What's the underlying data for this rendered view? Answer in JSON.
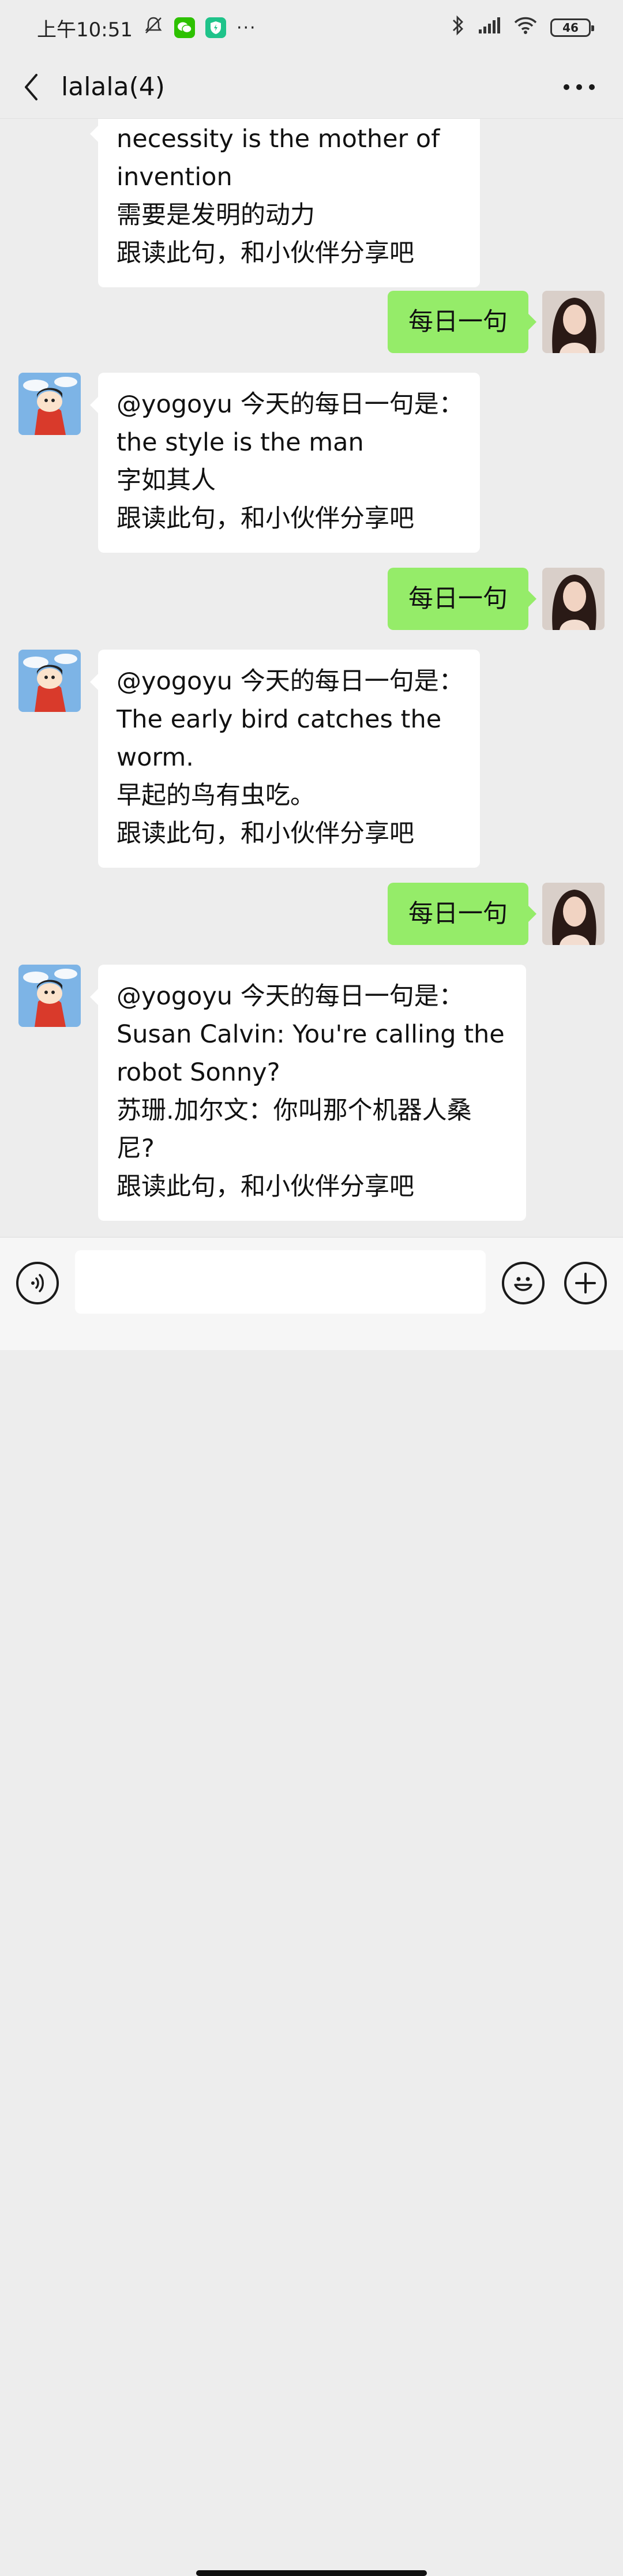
{
  "status_bar": {
    "time": "上午10:51",
    "more": "···",
    "battery": "46"
  },
  "header": {
    "title": "lalala(4)"
  },
  "messages": {
    "m0": {
      "lines": [
        "necessity is the mother of",
        "invention",
        "需要是发明的动力",
        "跟读此句，和小伙伴分享吧"
      ]
    },
    "m1": {
      "text": "每日一句"
    },
    "m2": {
      "lines": [
        "@yogoyu 今天的每日一句是：",
        "the style is the man",
        "字如其人",
        "跟读此句，和小伙伴分享吧"
      ]
    },
    "m3": {
      "text": "每日一句"
    },
    "m4": {
      "lines": [
        "@yogoyu 今天的每日一句是：",
        "The early bird catches the",
        "worm.",
        "早起的鸟有虫吃。",
        "跟读此句，和小伙伴分享吧"
      ]
    },
    "m5": {
      "text": "每日一句"
    },
    "m6": {
      "lines": [
        "@yogoyu 今天的每日一句是：",
        "Susan Calvin: You're calling the",
        "robot Sonny?",
        "苏珊.加尔文：你叫那个机器人桑",
        "尼?",
        "跟读此句，和小伙伴分享吧"
      ]
    }
  },
  "input_bar": {
    "value": "",
    "placeholder": ""
  },
  "colors": {
    "background": "#ededed",
    "outgoing_bubble": "#95ec69",
    "incoming_bubble": "#ffffff"
  },
  "icons": {
    "back": "chevron-left-icon",
    "more": "more-dots-icon",
    "voice": "voice-icon",
    "emoji": "emoji-icon",
    "plus": "plus-icon"
  }
}
